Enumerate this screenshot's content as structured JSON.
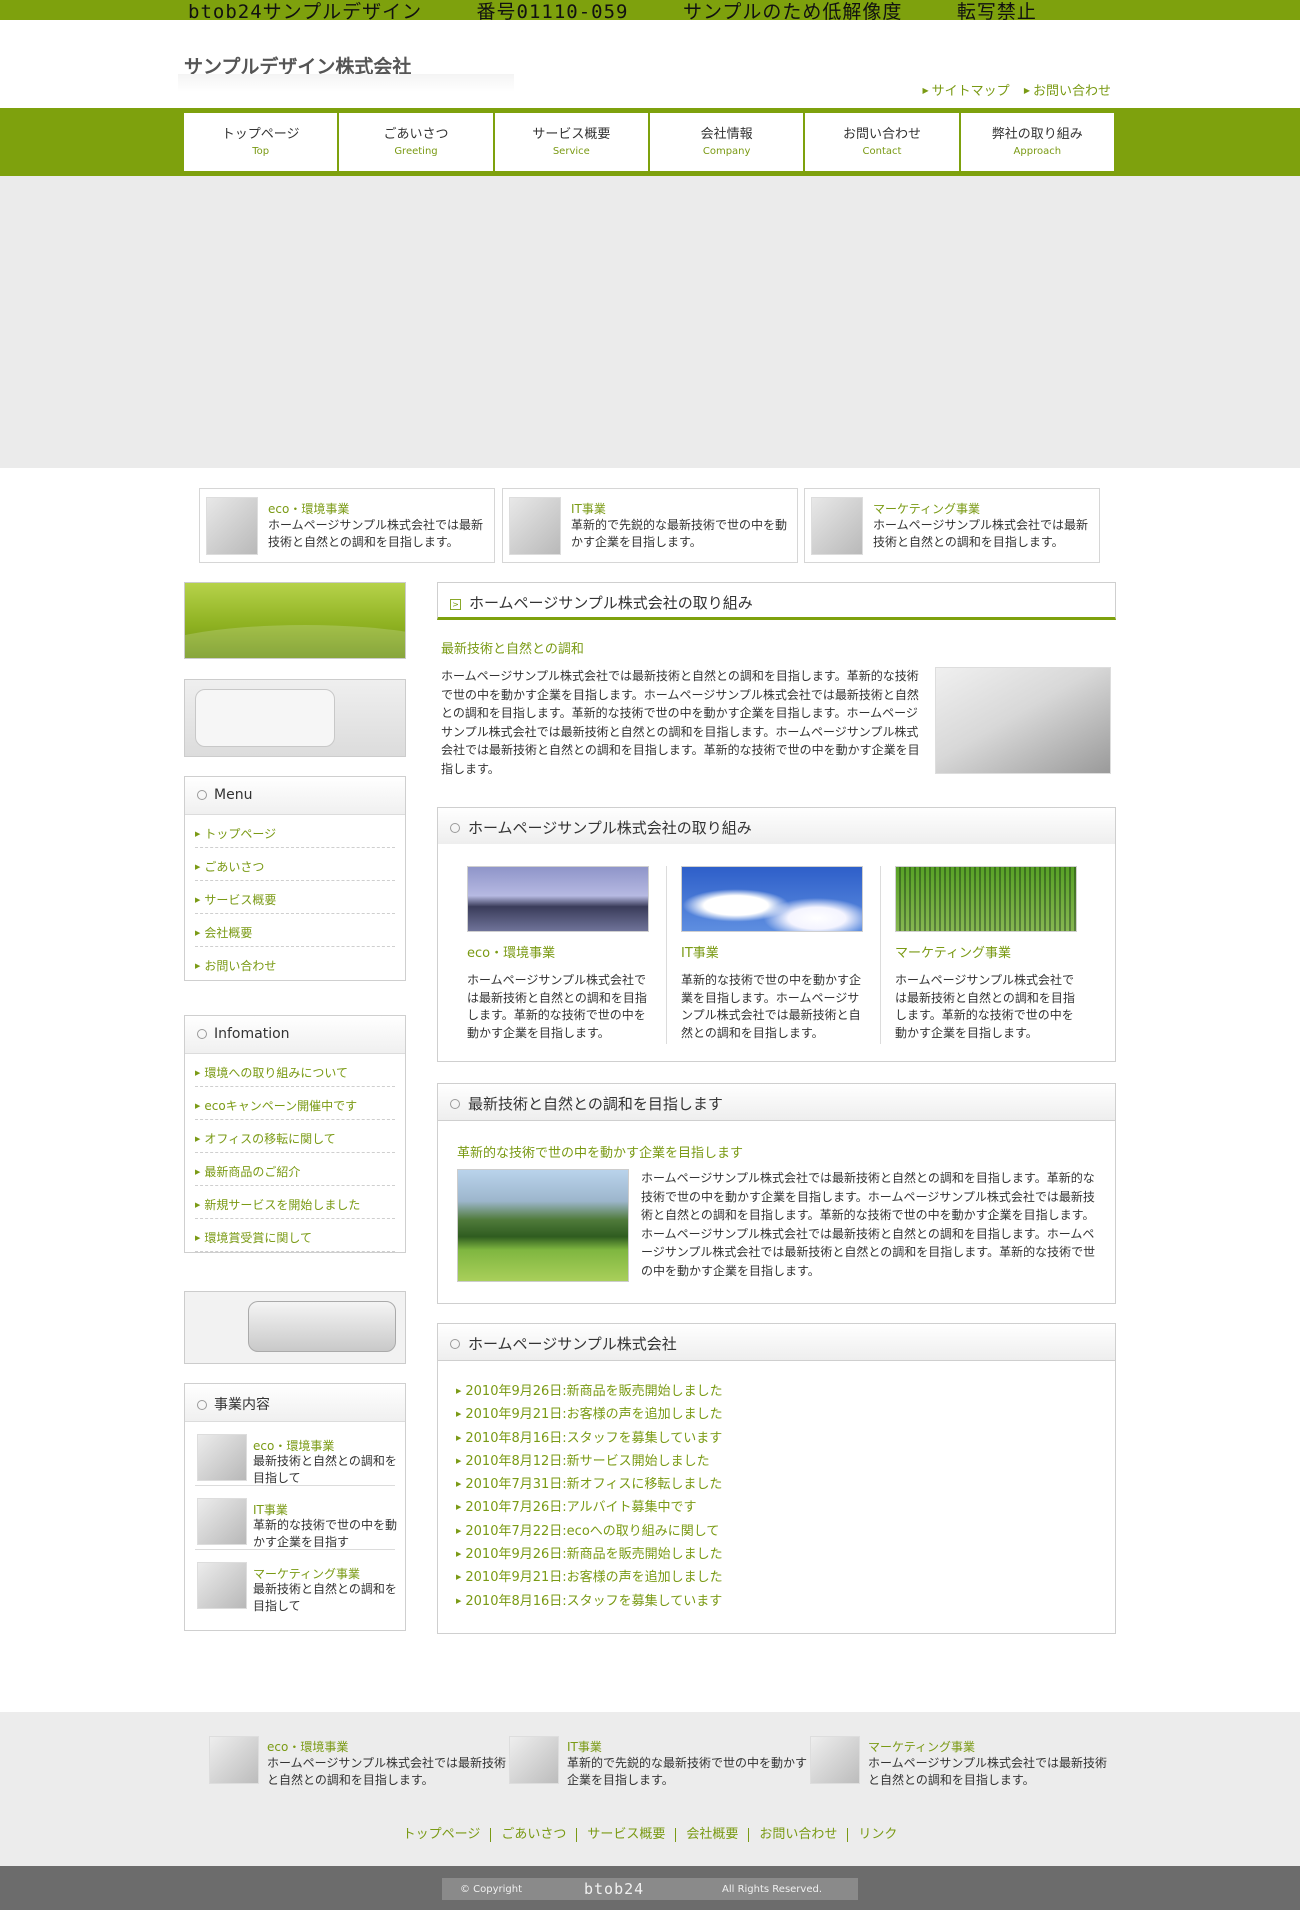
{
  "watermark": [
    "btob24サンプルデザイン",
    "番号01110-059",
    "サンプルのため低解像度",
    "転写禁止"
  ],
  "header": {
    "company": "サンプルデザイン株式会社",
    "links": [
      "サイトマップ",
      "お問い合わせ"
    ]
  },
  "nav": [
    {
      "jp": "トップページ",
      "en": "Top"
    },
    {
      "jp": "ごあいさつ",
      "en": "Greeting"
    },
    {
      "jp": "サービス概要",
      "en": "Service"
    },
    {
      "jp": "会社情報",
      "en": "Company"
    },
    {
      "jp": "お問い合わせ",
      "en": "Contact"
    },
    {
      "jp": "弊社の取り組み",
      "en": "Approach"
    }
  ],
  "features": [
    {
      "title": "eco・環境事業",
      "desc": "ホームページサンプル株式会社では最新技術と自然との調和を目指します。"
    },
    {
      "title": "IT事業",
      "desc": "革新的で先鋭的な最新技術で世の中を動かす企業を目指します。"
    },
    {
      "title": "マーケティング事業",
      "desc": "ホームページサンプル株式会社では最新技術と自然との調和を目指します。"
    }
  ],
  "sidebar": {
    "menu": {
      "title": "Menu",
      "items": [
        "トップページ",
        "ごあいさつ",
        "サービス概要",
        "会社概要",
        "お問い合わせ"
      ]
    },
    "info": {
      "title": "Infomation",
      "items": [
        "環境への取り組みについて",
        "ecoキャンペーン開催中です",
        "オフィスの移転に関して",
        "最新商品のご紹介",
        "新規サービスを開始しました",
        "環境賞受賞に関して"
      ]
    },
    "business": {
      "title": "事業内容",
      "items": [
        {
          "title": "eco・環境事業",
          "desc": "最新技術と自然との調和を目指して"
        },
        {
          "title": "IT事業",
          "desc": "革新的な技術で世の中を動かす企業を目指す"
        },
        {
          "title": "マーケティング事業",
          "desc": "最新技術と自然との調和を目指して"
        }
      ]
    }
  },
  "main": {
    "s1": {
      "title": "ホームページサンプル株式会社の取り組み",
      "sub": "最新技術と自然との調和",
      "text": "ホームページサンプル株式会社では最新技術と自然との調和を目指します。革新的な技術で世の中を動かす企業を目指します。ホームページサンプル株式会社では最新技術と自然との調和を目指します。革新的な技術で世の中を動かす企業を目指します。ホームページサンプル株式会社では最新技術と自然との調和を目指します。ホームページサンプル株式会社では最新技術と自然との調和を目指します。革新的な技術で世の中を動かす企業を目指します。"
    },
    "s2": {
      "title": "ホームページサンプル株式会社の取り組み",
      "cols": [
        {
          "title": "eco・環境事業",
          "desc": "ホームページサンプル株式会社では最新技術と自然との調和を目指します。革新的な技術で世の中を動かす企業を目指します。"
        },
        {
          "title": "IT事業",
          "desc": "革新的な技術で世の中を動かす企業を目指します。ホームページサンプル株式会社では最新技術と自然との調和を目指します。"
        },
        {
          "title": "マーケティング事業",
          "desc": "ホームページサンプル株式会社では最新技術と自然との調和を目指します。革新的な技術で世の中を動かす企業を目指します。"
        }
      ]
    },
    "s3": {
      "title": "最新技術と自然との調和を目指します",
      "sub": "革新的な技術で世の中を動かす企業を目指します",
      "text": "ホームページサンプル株式会社では最新技術と自然との調和を目指します。革新的な技術で世の中を動かす企業を目指します。ホームページサンプル株式会社では最新技術と自然との調和を目指します。革新的な技術で世の中を動かす企業を目指します。ホームページサンプル株式会社では最新技術と自然との調和を目指します。ホームページサンプル株式会社では最新技術と自然との調和を目指します。革新的な技術で世の中を動かす企業を目指します。"
    },
    "s4": {
      "title": "ホームページサンプル株式会社",
      "news": [
        "2010年9月26日:新商品を販売開始しました",
        "2010年9月21日:お客様の声を追加しました",
        "2010年8月16日:スタッフを募集しています",
        "2010年8月12日:新サービス開始しました",
        "2010年7月31日:新オフィスに移転しました",
        "2010年7月26日:アルバイト募集中です",
        "2010年7月22日:ecoへの取り組みに関して",
        "2010年9月26日:新商品を販売開始しました",
        "2010年9月21日:お客様の声を追加しました",
        "2010年8月16日:スタッフを募集しています"
      ]
    }
  },
  "footer": {
    "features": [
      {
        "title": "eco・環境事業",
        "desc": "ホームページサンプル株式会社では最新技術と自然との調和を目指します。"
      },
      {
        "title": "IT事業",
        "desc": "革新的で先鋭的な最新技術で世の中を動かす企業を目指します。"
      },
      {
        "title": "マーケティング事業",
        "desc": "ホームページサンプル株式会社では最新技術と自然との調和を目指します。"
      }
    ],
    "links": [
      "トップページ",
      "ごあいさつ",
      "サービス概要",
      "会社概要",
      "お問い合わせ",
      "リンク"
    ],
    "copyright_label": "© Copyright",
    "brand": "btob24",
    "rights": "All Rights Reserved."
  },
  "colors": {
    "accent": "#7ea10d",
    "link": "#7a9a14",
    "hero_bg": "#ebebeb"
  }
}
